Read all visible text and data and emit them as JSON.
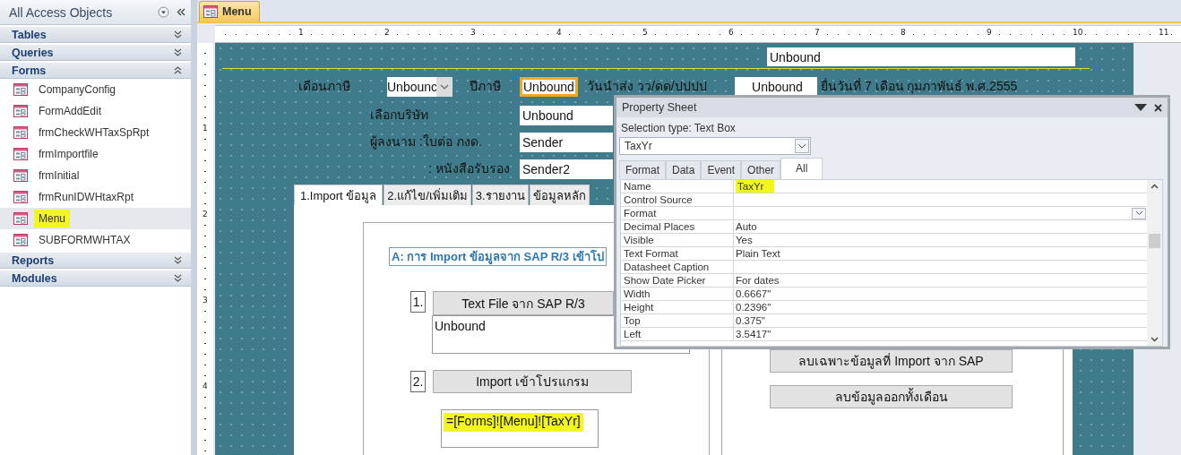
{
  "nav_pane": {
    "title": "All Access Objects",
    "groups": [
      {
        "label": "Tables",
        "expanded": false
      },
      {
        "label": "Queries",
        "expanded": false
      },
      {
        "label": "Forms",
        "expanded": true,
        "items": [
          {
            "label": "CompanyConfig",
            "selected": false,
            "highlighted": false
          },
          {
            "label": "FormAddEdit",
            "selected": false,
            "highlighted": false
          },
          {
            "label": "frmCheckWHTaxSpRpt",
            "selected": false,
            "highlighted": false
          },
          {
            "label": "frmImportfile",
            "selected": false,
            "highlighted": false
          },
          {
            "label": "frmInitial",
            "selected": false,
            "highlighted": false
          },
          {
            "label": "frmRunIDWHtaxRpt",
            "selected": false,
            "highlighted": false
          },
          {
            "label": "Menu",
            "selected": true,
            "highlighted": true
          },
          {
            "label": "SUBFORMWHTAX",
            "selected": false,
            "highlighted": false
          }
        ]
      },
      {
        "label": "Reports",
        "expanded": false
      },
      {
        "label": "Modules",
        "expanded": false
      }
    ]
  },
  "document_tabs": [
    {
      "label": "Menu",
      "selected": true
    }
  ],
  "rulers": {
    "horizontal": [
      "1",
      "2",
      "3",
      "4",
      "5",
      "6",
      "7",
      "8",
      "9",
      "10",
      "11"
    ],
    "vertical": [
      "1",
      "2",
      "3",
      "4"
    ]
  },
  "form": {
    "controls": [
      {
        "kind": "textbox",
        "text": "Unbound",
        "selected": false
      },
      {
        "kind": "label",
        "text": "เดือนภาษี",
        "selected": false
      },
      {
        "kind": "combobox",
        "text": "Unbounc",
        "selected": false
      },
      {
        "kind": "label",
        "text": "ปีภาษี",
        "selected": false
      },
      {
        "kind": "textbox",
        "text": "Unbound",
        "selected": true
      },
      {
        "kind": "label",
        "text": "วันนำส่ง วว/ดด/ปปปป",
        "selected": false
      },
      {
        "kind": "textbox",
        "text": "Unbound",
        "selected": false
      },
      {
        "kind": "label",
        "text": "ยื่นวันที่ 7 เดือน กุมภาพันธ์ พ.ศ.2555",
        "selected": false
      },
      {
        "kind": "label",
        "text": "เลือกบริษัท",
        "selected": false
      },
      {
        "kind": "textbox",
        "text": "Unbound",
        "selected": false
      },
      {
        "kind": "label",
        "text": "ผู้ลงนาม :ใบต่อ ภงด.",
        "selected": false
      },
      {
        "kind": "textbox",
        "text": "Sender",
        "selected": false
      },
      {
        "kind": "label",
        "text": ": หนังสือรับรอง",
        "selected": false
      },
      {
        "kind": "textbox",
        "text": "Sender2",
        "selected": false
      }
    ],
    "tab_control": {
      "tabs": [
        {
          "label": "1.Import ข้อมูล",
          "selected": true
        },
        {
          "label": "2.แก้ไข/เพิ่มเติม",
          "selected": false
        },
        {
          "label": "3.รายงาน",
          "selected": false
        },
        {
          "label": "ข้อมูลหลัก",
          "selected": false
        }
      ],
      "page_controls": [
        {
          "kind": "heading",
          "text": "A: การ Import ข้อมูลจาก SAP R/3 เข้าโป"
        },
        {
          "kind": "step-number",
          "text": "1."
        },
        {
          "kind": "button",
          "text": "Text File จาก SAP R/3"
        },
        {
          "kind": "textbox",
          "text": "Unbound",
          "highlighted": false
        },
        {
          "kind": "step-number",
          "text": "2."
        },
        {
          "kind": "button",
          "text": "Import เข้าโปรแกรม"
        },
        {
          "kind": "textbox",
          "text": "=[Forms]![Menu]![TaxYr]",
          "highlighted": true
        },
        {
          "kind": "button",
          "text": "ลบเฉพาะข้อมูลที่ Import จาก SAP"
        },
        {
          "kind": "button",
          "text": "ลบข้อมูลออกทั้งเดือน"
        }
      ]
    }
  },
  "property_sheet": {
    "title": "Property Sheet",
    "selection_type": "Selection type:  Text Box",
    "object": "TaxYr",
    "tabs": [
      {
        "label": "Format",
        "selected": false
      },
      {
        "label": "Data",
        "selected": false
      },
      {
        "label": "Event",
        "selected": false
      },
      {
        "label": "Other",
        "selected": false
      },
      {
        "label": "All",
        "selected": true
      }
    ],
    "rows": [
      {
        "property": "Name",
        "value": "TaxYr",
        "highlighted": true,
        "dropdown": false
      },
      {
        "property": "Control Source",
        "dropdown": false
      },
      {
        "property": "Format",
        "dropdown": true
      },
      {
        "property": "Decimal Places",
        "value": "Auto",
        "highlighted": false,
        "dropdown": false
      },
      {
        "property": "Visible",
        "value": "Yes",
        "highlighted": false,
        "dropdown": false
      },
      {
        "property": "Text Format",
        "value": "Plain Text",
        "highlighted": false,
        "dropdown": false
      },
      {
        "property": "Datasheet Caption",
        "dropdown": false
      },
      {
        "property": "Show Date Picker",
        "value": "For dates",
        "highlighted": false,
        "dropdown": false
      },
      {
        "property": "Width",
        "value": "0.6667\"",
        "highlighted": false,
        "dropdown": false
      },
      {
        "property": "Height",
        "value": "0.2396\"",
        "highlighted": false,
        "dropdown": false
      },
      {
        "property": "Top",
        "value": "0.375\"",
        "highlighted": false,
        "dropdown": false
      },
      {
        "property": "Left",
        "value": "3.5417\"",
        "highlighted": false,
        "dropdown": false
      }
    ]
  }
}
